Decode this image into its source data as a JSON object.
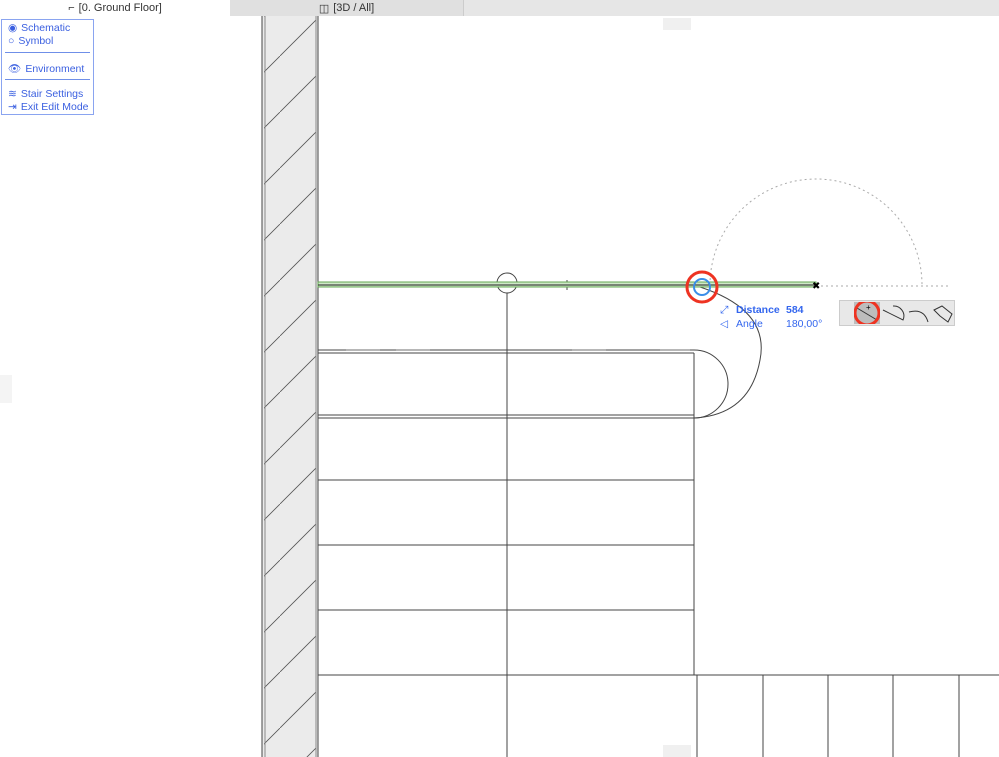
{
  "tabs": [
    {
      "label": "[0. Ground Floor]",
      "icon": "floor-plan-icon"
    },
    {
      "label": "[3D / All]",
      "icon": "cube-3d-icon"
    }
  ],
  "menu": {
    "items": [
      {
        "label": "Schematic",
        "icon": "radio-selected-icon"
      },
      {
        "label": "Symbol",
        "icon": "radio-icon"
      },
      {
        "label": "Environment",
        "icon": "eye-icon"
      },
      {
        "label": "Stair Settings",
        "icon": "stair-settings-icon"
      },
      {
        "label": "Exit Edit Mode",
        "icon": "exit-icon"
      }
    ]
  },
  "tracker": {
    "distance_label": "Distance",
    "distance_value": "584",
    "angle_label": "Angle",
    "angle_value": "180,00°"
  },
  "pet_palette": [
    "straight-segment",
    "arc-tangent-segment",
    "arc-segment",
    "stair-landing"
  ],
  "colors": {
    "accent": "#3366ee",
    "highlight": "#ee3322",
    "green": "#66aa55"
  }
}
